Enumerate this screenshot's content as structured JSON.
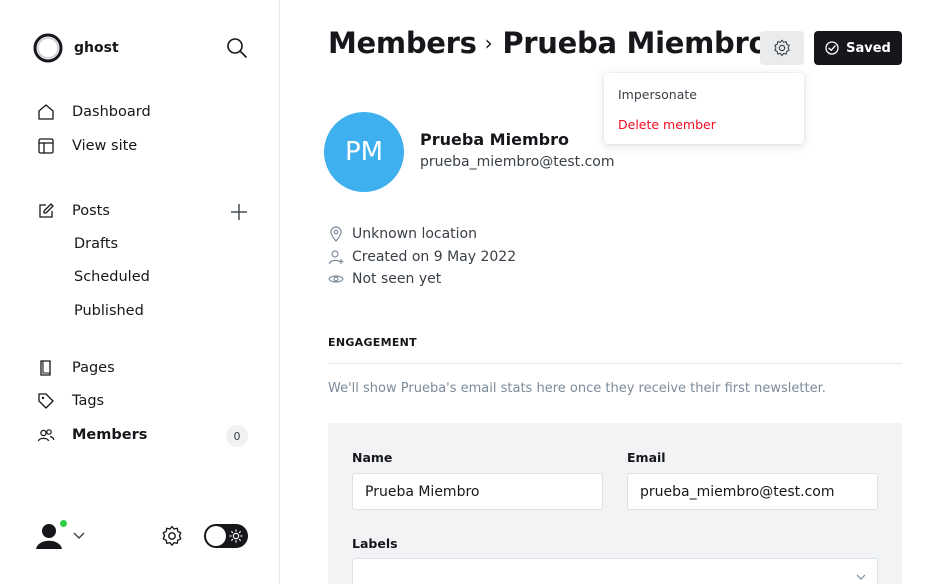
{
  "brand": {
    "name": "ghost",
    "logo_icon": "ghost-logo-icon"
  },
  "sidebar": {
    "items": [
      {
        "label": "Dashboard",
        "icon": "home-icon"
      },
      {
        "label": "View site",
        "icon": "window-icon"
      },
      {
        "label": "Posts",
        "icon": "edit-icon"
      },
      {
        "label": "Drafts"
      },
      {
        "label": "Scheduled"
      },
      {
        "label": "Published"
      },
      {
        "label": "Pages",
        "icon": "page-icon"
      },
      {
        "label": "Tags",
        "icon": "tag-icon"
      },
      {
        "label": "Members",
        "icon": "members-icon",
        "count": "0"
      }
    ]
  },
  "header": {
    "section": "Members",
    "separator": "›",
    "member": "Prueba Miembro",
    "saved_label": "Saved"
  },
  "dropdown": {
    "impersonate": "Impersonate",
    "delete": "Delete member"
  },
  "member": {
    "initials": "PM",
    "name": "Prueba Miembro",
    "email": "prueba_miembro@test.com",
    "avatar_color": "#3eb0ef",
    "location": "Unknown location",
    "created": "Created on 9 May 2022",
    "seen": "Not seen yet"
  },
  "engagement": {
    "title": "ENGAGEMENT",
    "note": "We'll show Prueba's email stats here once they receive their first newsletter."
  },
  "form": {
    "name_label": "Name",
    "name_value": "Prueba Miembro",
    "email_label": "Email",
    "email_value": "prueba_miembro@test.com",
    "labels_label": "Labels",
    "labels_value": ""
  },
  "colors": {
    "accent": "#15171a",
    "danger": "#f50b23",
    "online": "#30cf43"
  }
}
